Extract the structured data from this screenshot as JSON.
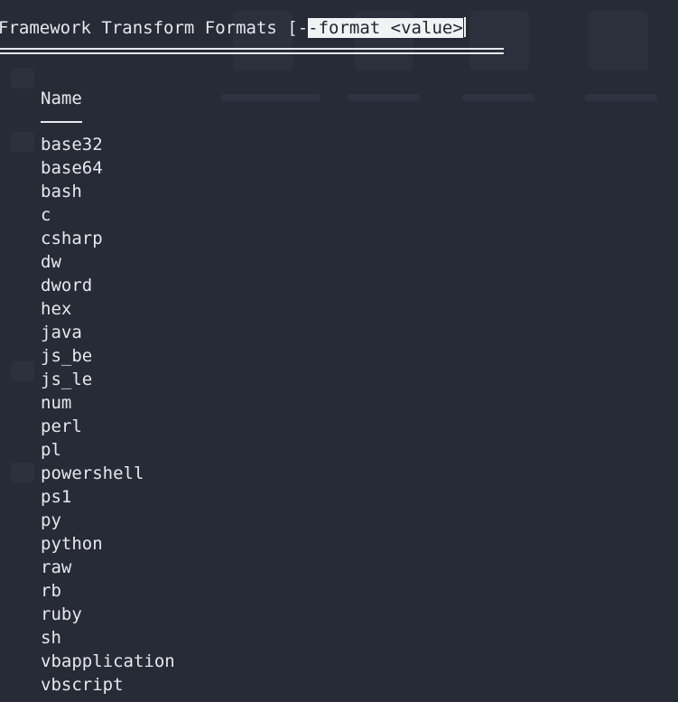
{
  "terminal": {
    "title_prefix": "Framework Transform Formats [-",
    "title_selected": "-format <value>",
    "column_header": "Name",
    "formats": [
      "base32",
      "base64",
      "bash",
      "c",
      "csharp",
      "dw",
      "dword",
      "hex",
      "java",
      "js_be",
      "js_le",
      "num",
      "perl",
      "pl",
      "powershell",
      "ps1",
      "py",
      "python",
      "raw",
      "rb",
      "ruby",
      "sh",
      "vbapplication",
      "vbscript"
    ]
  },
  "colors": {
    "background": "#262b36",
    "text": "#e6e8ee",
    "selection": "#f1f2f4"
  }
}
